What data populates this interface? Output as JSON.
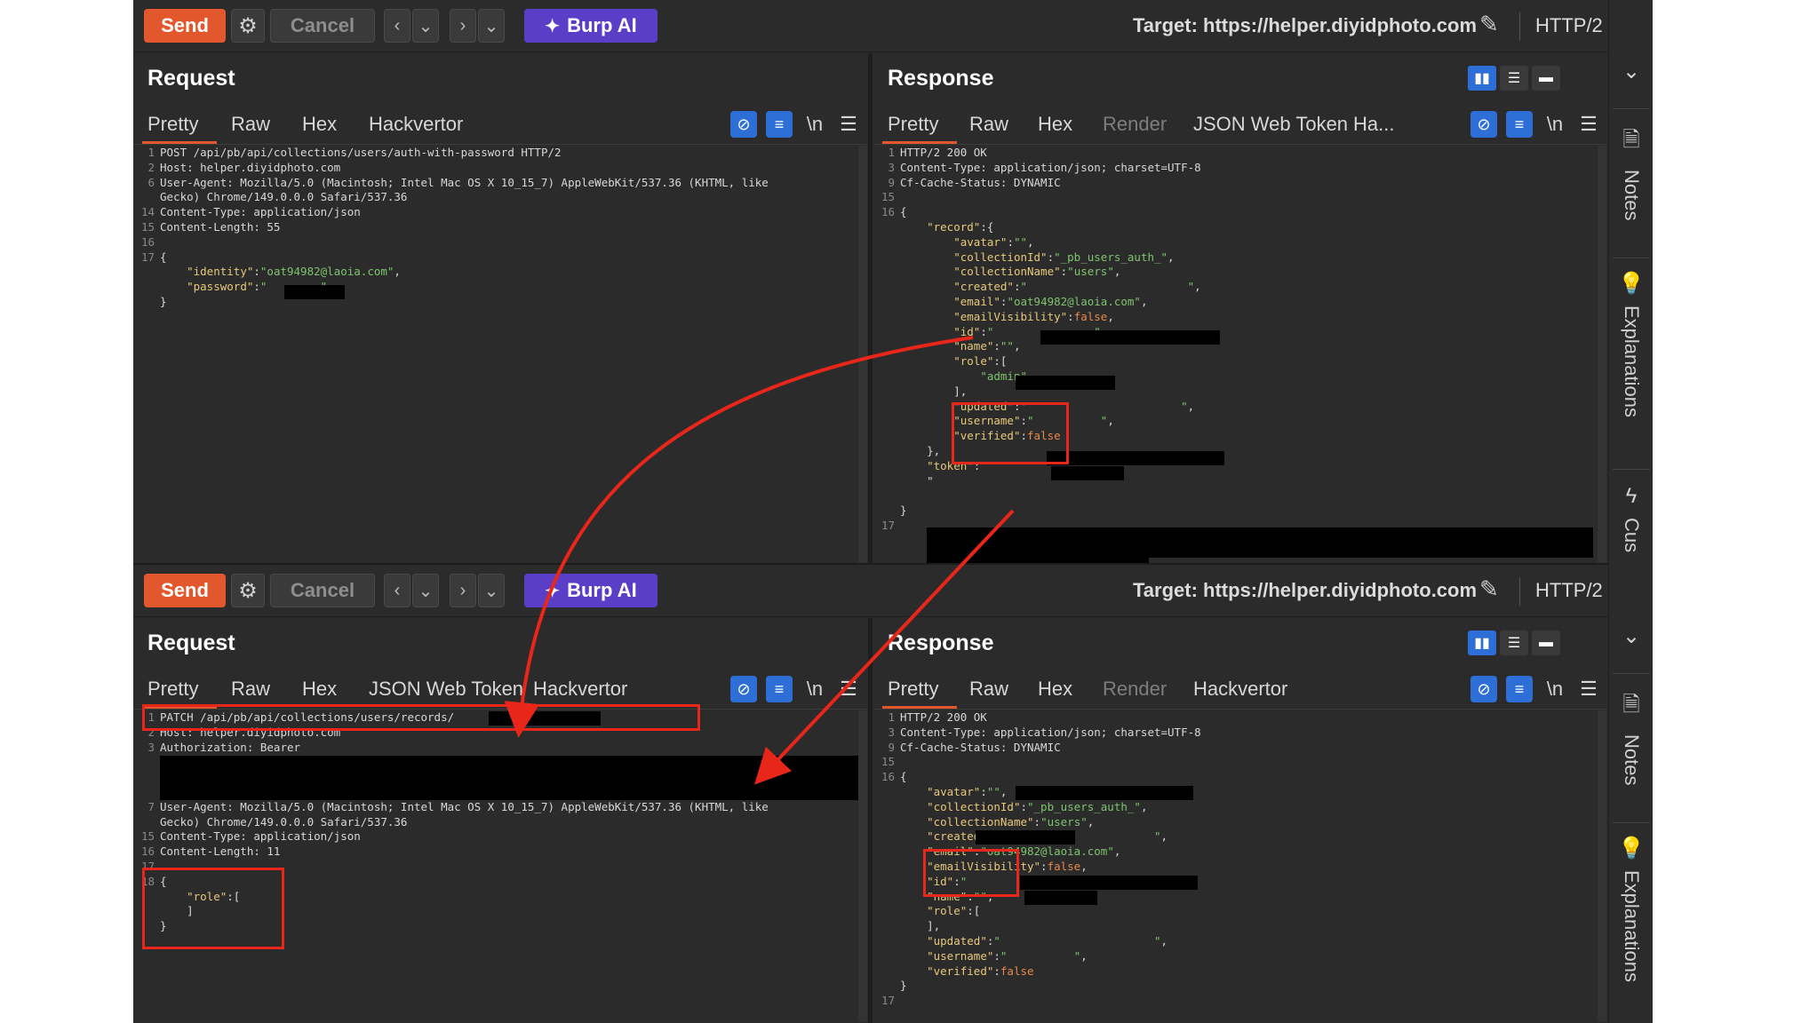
{
  "toolbar": {
    "send": "Send",
    "cancel": "Cancel",
    "burp_ai": "Burp AI",
    "target": "Target: https://helper.diyidphoto.com",
    "protocol": "HTTP/2"
  },
  "request": {
    "title": "Request",
    "tabs_top": [
      "Pretty",
      "Raw",
      "Hex",
      "Hackvertor"
    ],
    "tabs_bottom": [
      "Pretty",
      "Raw",
      "Hex",
      "JSON Web Token",
      "Hackvertor"
    ],
    "newline_toggle": "\\n"
  },
  "response": {
    "title": "Response",
    "tabs_top": [
      "Pretty",
      "Raw",
      "Hex",
      "Render",
      "JSON Web Token",
      "Ha..."
    ],
    "tabs_bottom": [
      "Pretty",
      "Raw",
      "Hex",
      "Render",
      "Hackvertor"
    ],
    "newline_toggle": "\\n"
  },
  "top_request": {
    "lines": [
      {
        "n": "1",
        "t": "POST /api/pb/api/collections/users/auth-with-password HTTP/2"
      },
      {
        "n": "2",
        "t": "Host: helper.diyidphoto.com"
      },
      {
        "n": "6",
        "t": "User-Agent: Mozilla/5.0 (Macintosh; Intel Mac OS X 10_15_7) AppleWebKit/537.36 (KHTML, like"
      },
      {
        "n": "",
        "t": "Gecko) Chrome/149.0.0.0 Safari/537.36"
      },
      {
        "n": "14",
        "t": "Content-Type: application/json"
      },
      {
        "n": "15",
        "t": "Content-Length: 55"
      },
      {
        "n": "16",
        "t": ""
      },
      {
        "n": "17",
        "t": "{"
      },
      {
        "n": "",
        "t": "    \"identity\":\"oat94982@laoia.com\","
      },
      {
        "n": "",
        "t": "    \"password\":\"        \""
      },
      {
        "n": "",
        "t": "}"
      }
    ]
  },
  "top_response": {
    "lines": [
      {
        "n": "1",
        "t": "HTTP/2 200 OK"
      },
      {
        "n": "3",
        "t": "Content-Type: application/json; charset=UTF-8"
      },
      {
        "n": "9",
        "t": "Cf-Cache-Status: DYNAMIC"
      },
      {
        "n": "15",
        "t": ""
      },
      {
        "n": "16",
        "t": "{"
      },
      {
        "n": "",
        "t": "    \"record\":{"
      },
      {
        "n": "",
        "t": "        \"avatar\":\"\","
      },
      {
        "n": "",
        "t": "        \"collectionId\":\"_pb_users_auth_\","
      },
      {
        "n": "",
        "t": "        \"collectionName\":\"users\","
      },
      {
        "n": "",
        "t": "        \"created\":\"                        \","
      },
      {
        "n": "",
        "t": "        \"email\":\"oat94982@laoia.com\","
      },
      {
        "n": "",
        "t": "        \"emailVisibility\":false,"
      },
      {
        "n": "",
        "t": "        \"id\":\"               \","
      },
      {
        "n": "",
        "t": "        \"name\":\"\","
      },
      {
        "n": "",
        "t": "        \"role\":["
      },
      {
        "n": "",
        "t": "            \"admin\""
      },
      {
        "n": "",
        "t": "        ],"
      },
      {
        "n": "",
        "t": "        \"updated\":\"                       \","
      },
      {
        "n": "",
        "t": "        \"username\":\"          \","
      },
      {
        "n": "",
        "t": "        \"verified\":false"
      },
      {
        "n": "",
        "t": "    },"
      },
      {
        "n": "",
        "t": "    \"token\":"
      },
      {
        "n": "",
        "t": "    \""
      },
      {
        "n": "",
        "t": ""
      },
      {
        "n": "",
        "t": "}"
      },
      {
        "n": "17",
        "t": ""
      }
    ]
  },
  "bottom_request": {
    "lines": [
      {
        "n": "1",
        "t": "PATCH /api/pb/api/collections/users/records/                HTTP/2"
      },
      {
        "n": "2",
        "t": "Host: helper.diyidphoto.com"
      },
      {
        "n": "3",
        "t": "Authorization: Bearer"
      },
      {
        "n": "",
        "t": ""
      },
      {
        "n": "",
        "t": ""
      },
      {
        "n": "",
        "t": ""
      },
      {
        "n": "7",
        "t": "User-Agent: Mozilla/5.0 (Macintosh; Intel Mac OS X 10_15_7) AppleWebKit/537.36 (KHTML, like"
      },
      {
        "n": "",
        "t": "Gecko) Chrome/149.0.0.0 Safari/537.36"
      },
      {
        "n": "15",
        "t": "Content-Type: application/json"
      },
      {
        "n": "16",
        "t": "Content-Length: 11"
      },
      {
        "n": "17",
        "t": ""
      },
      {
        "n": "18",
        "t": "{"
      },
      {
        "n": "",
        "t": "    \"role\":["
      },
      {
        "n": "",
        "t": "    ]"
      },
      {
        "n": "",
        "t": "}"
      }
    ]
  },
  "bottom_response": {
    "lines": [
      {
        "n": "1",
        "t": "HTTP/2 200 OK"
      },
      {
        "n": "3",
        "t": "Content-Type: application/json; charset=UTF-8"
      },
      {
        "n": "9",
        "t": "Cf-Cache-Status: DYNAMIC"
      },
      {
        "n": "15",
        "t": ""
      },
      {
        "n": "16",
        "t": "{"
      },
      {
        "n": "",
        "t": "    \"avatar\":\"\","
      },
      {
        "n": "",
        "t": "    \"collectionId\":\"_pb_users_auth_\","
      },
      {
        "n": "",
        "t": "    \"collectionName\":\"users\","
      },
      {
        "n": "",
        "t": "    \"created\":\"                       \","
      },
      {
        "n": "",
        "t": "    \"email\":\"oat94982@laoia.com\","
      },
      {
        "n": "",
        "t": "    \"emailVisibility\":false,"
      },
      {
        "n": "",
        "t": "    \"id\":\"               \","
      },
      {
        "n": "",
        "t": "    \"name\":\"\","
      },
      {
        "n": "",
        "t": "    \"role\":["
      },
      {
        "n": "",
        "t": "    ],"
      },
      {
        "n": "",
        "t": "    \"updated\":\"                       \","
      },
      {
        "n": "",
        "t": "    \"username\":\"          \","
      },
      {
        "n": "",
        "t": "    \"verified\":false"
      },
      {
        "n": "",
        "t": "}"
      },
      {
        "n": "17",
        "t": ""
      }
    ]
  },
  "sidebar": {
    "items": [
      "Notes",
      "Explanations",
      "Cus"
    ],
    "icons": [
      "notes-icon",
      "lightbulb-icon",
      "lightning-icon"
    ]
  },
  "colors": {
    "send": "#e2582c",
    "burp_ai": "#5a3ec8",
    "highlight": "#e8261a",
    "key": "#e8c97a",
    "string": "#7ec46e",
    "bool": "#e8894a"
  }
}
